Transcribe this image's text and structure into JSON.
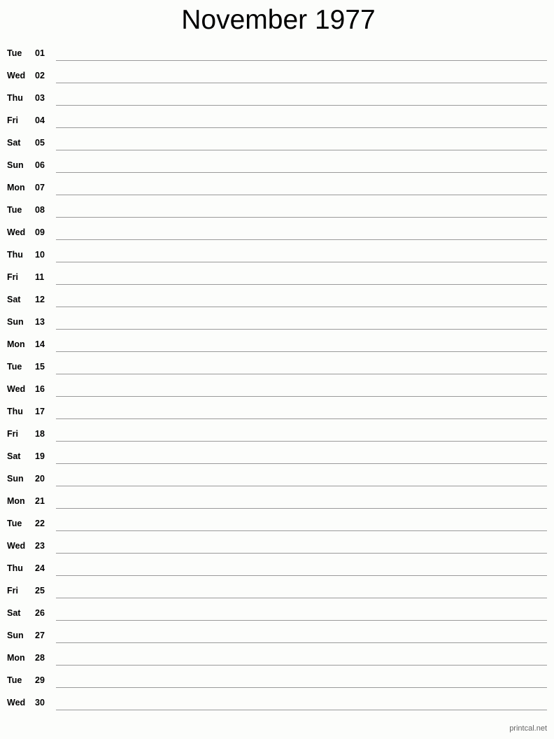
{
  "title": "November 1977",
  "days": [
    {
      "dow": "Tue",
      "num": "01"
    },
    {
      "dow": "Wed",
      "num": "02"
    },
    {
      "dow": "Thu",
      "num": "03"
    },
    {
      "dow": "Fri",
      "num": "04"
    },
    {
      "dow": "Sat",
      "num": "05"
    },
    {
      "dow": "Sun",
      "num": "06"
    },
    {
      "dow": "Mon",
      "num": "07"
    },
    {
      "dow": "Tue",
      "num": "08"
    },
    {
      "dow": "Wed",
      "num": "09"
    },
    {
      "dow": "Thu",
      "num": "10"
    },
    {
      "dow": "Fri",
      "num": "11"
    },
    {
      "dow": "Sat",
      "num": "12"
    },
    {
      "dow": "Sun",
      "num": "13"
    },
    {
      "dow": "Mon",
      "num": "14"
    },
    {
      "dow": "Tue",
      "num": "15"
    },
    {
      "dow": "Wed",
      "num": "16"
    },
    {
      "dow": "Thu",
      "num": "17"
    },
    {
      "dow": "Fri",
      "num": "18"
    },
    {
      "dow": "Sat",
      "num": "19"
    },
    {
      "dow": "Sun",
      "num": "20"
    },
    {
      "dow": "Mon",
      "num": "21"
    },
    {
      "dow": "Tue",
      "num": "22"
    },
    {
      "dow": "Wed",
      "num": "23"
    },
    {
      "dow": "Thu",
      "num": "24"
    },
    {
      "dow": "Fri",
      "num": "25"
    },
    {
      "dow": "Sat",
      "num": "26"
    },
    {
      "dow": "Sun",
      "num": "27"
    },
    {
      "dow": "Mon",
      "num": "28"
    },
    {
      "dow": "Tue",
      "num": "29"
    },
    {
      "dow": "Wed",
      "num": "30"
    }
  ],
  "footer": "printcal.net"
}
